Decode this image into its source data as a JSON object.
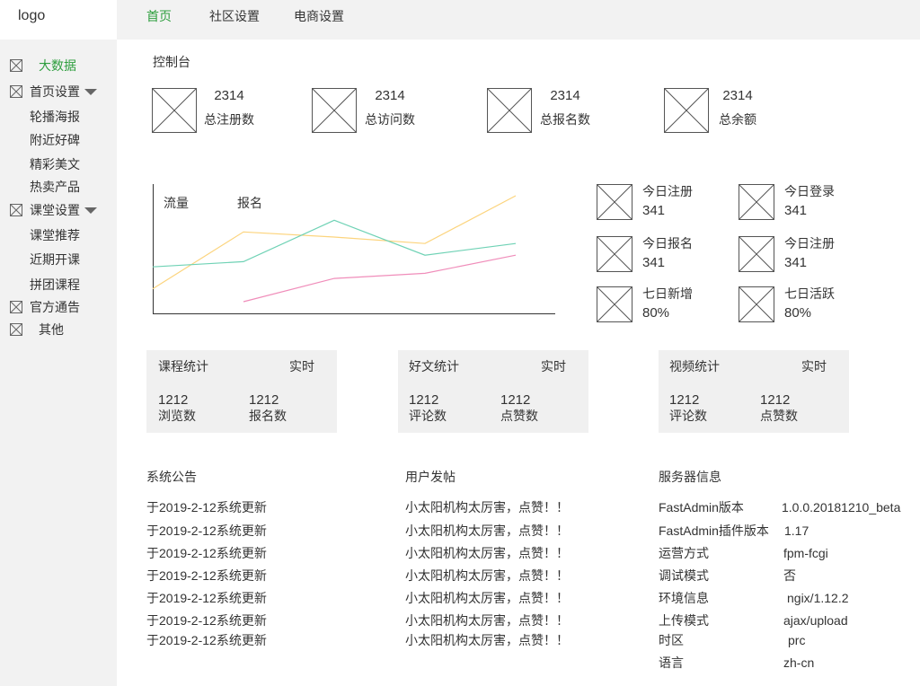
{
  "theme": {
    "accent_color": "#2e9e3e",
    "chrome_background": "#f2f2f2",
    "panel_background": "#f0f0f0",
    "text_color": "#333333"
  },
  "header": {
    "logo": "logo",
    "nav": [
      {
        "label": "首页",
        "active": true
      },
      {
        "label": "社区设置",
        "active": false
      },
      {
        "label": "电商设置",
        "active": false
      }
    ]
  },
  "sidebar": {
    "items": [
      {
        "label": "大数据",
        "icon": "image-placeholder",
        "active": true
      },
      {
        "label": "首页设置",
        "icon": "image-placeholder",
        "toggle_icon": "caret-down"
      },
      {
        "label": "轮播海报"
      },
      {
        "label": "附近好碑"
      },
      {
        "label": "精彩美文"
      },
      {
        "label": "热卖产品"
      },
      {
        "label": "课堂设置",
        "icon": "image-placeholder",
        "toggle_icon": "caret-down"
      },
      {
        "label": "课堂推荐"
      },
      {
        "label": "近期开课"
      },
      {
        "label": "拼团课程"
      },
      {
        "label": "官方通告",
        "icon": "image-placeholder"
      },
      {
        "label": "其他",
        "icon": "image-placeholder"
      }
    ]
  },
  "dashboard": {
    "title": "控制台",
    "totals": [
      {
        "value": "2314",
        "label": "总注册数",
        "icon": "image-placeholder"
      },
      {
        "value": "2314",
        "label": "总访问数",
        "icon": "image-placeholder"
      },
      {
        "value": "2314",
        "label": "总报名数",
        "icon": "image-placeholder"
      },
      {
        "value": "2314",
        "label": "总余额",
        "icon": "image-placeholder"
      }
    ],
    "quick_stats": [
      {
        "label": "今日注册",
        "value": "341",
        "icon": "image-placeholder"
      },
      {
        "label": "今日登录",
        "value": "341",
        "icon": "image-placeholder"
      },
      {
        "label": "今日报名",
        "value": "341",
        "icon": "image-placeholder"
      },
      {
        "label": "今日注册",
        "value": "341",
        "icon": "image-placeholder"
      },
      {
        "label": "七日新增",
        "value": "80%",
        "icon": "image-placeholder"
      },
      {
        "label": "七日活跃",
        "value": "80%",
        "icon": "image-placeholder"
      }
    ],
    "stat_panels": [
      {
        "title": "课程统计",
        "tag": "实时",
        "metrics": [
          {
            "value": "1212",
            "label": "浏览数"
          },
          {
            "value": "1212",
            "label": "报名数"
          }
        ]
      },
      {
        "title": "好文统计",
        "tag": "实时",
        "metrics": [
          {
            "value": "1212",
            "label": "评论数"
          },
          {
            "value": "1212",
            "label": "点赞数"
          }
        ]
      },
      {
        "title": "视频统计",
        "tag": "实时",
        "metrics": [
          {
            "value": "1212",
            "label": "评论数"
          },
          {
            "value": "1212",
            "label": "点赞数"
          }
        ]
      }
    ],
    "announcements": {
      "title": "系统公告",
      "items": [
        "于2019-2-12系统更新",
        "于2019-2-12系统更新",
        "于2019-2-12系统更新",
        "于2019-2-12系统更新",
        "于2019-2-12系统更新",
        "于2019-2-12系统更新",
        "于2019-2-12系统更新"
      ]
    },
    "user_posts": {
      "title": "用户发帖",
      "items": [
        "小太阳机构太厉害，点赞！！",
        "小太阳机构太厉害，点赞！！",
        "小太阳机构太厉害，点赞！！",
        "小太阳机构太厉害，点赞！！",
        "小太阳机构太厉害，点赞！！",
        "小太阳机构太厉害，点赞！！",
        "小太阳机构太厉害，点赞！！"
      ]
    },
    "server_info": {
      "title": "服务器信息",
      "rows": [
        {
          "key": "FastAdmin版本",
          "value": "1.0.0.20181210_beta"
        },
        {
          "key": "FastAdmin插件版本",
          "value": "1.17"
        },
        {
          "key": "运营方式",
          "value": "fpm-fcgi"
        },
        {
          "key": "调试模式",
          "value": "否"
        },
        {
          "key": "环境信息",
          "value": "ngix/1.12.2"
        },
        {
          "key": "上传模式",
          "value": "ajax/upload"
        },
        {
          "key": "时区",
          "value": "prc"
        },
        {
          "key": "语言",
          "value": "zh-cn"
        }
      ]
    }
  },
  "chart_data": {
    "type": "line",
    "legend": [
      "流量",
      "报名"
    ],
    "grid": false,
    "ylim": [
      0,
      100
    ],
    "series": [
      {
        "color": "#fcd47d",
        "values": [
          19,
          63,
          59,
          54,
          91
        ]
      },
      {
        "color": "#6fd2b5",
        "values": [
          36,
          40,
          72,
          45,
          54
        ]
      },
      {
        "color": "#f08dba",
        "values": [
          null,
          9,
          27,
          31,
          45
        ]
      }
    ]
  }
}
